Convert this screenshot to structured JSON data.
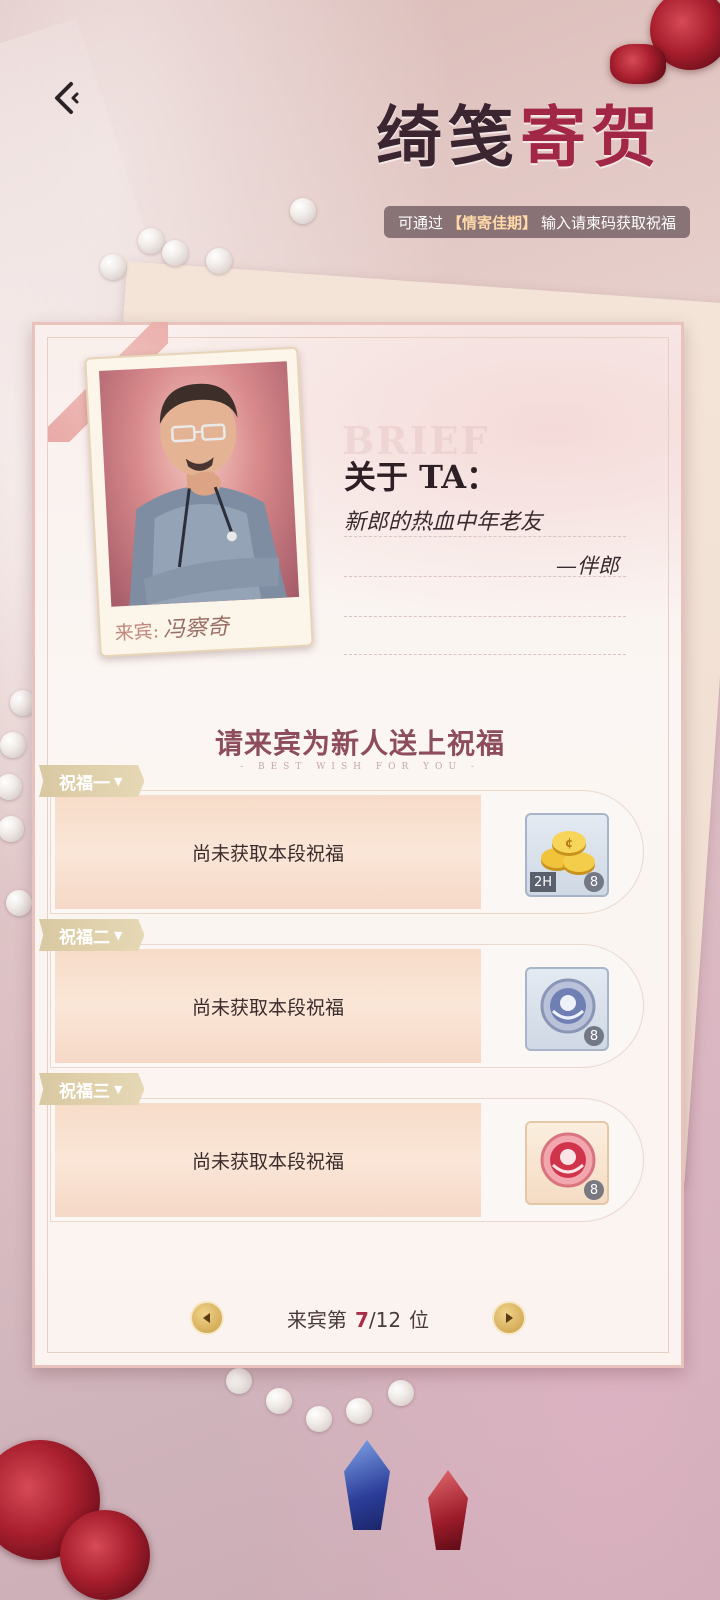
{
  "header": {
    "title_part1": "绮笺",
    "title_part2": "寄贺",
    "subtitle_pre": "可通过",
    "subtitle_highlight": "【情寄佳期】",
    "subtitle_post": "输入请柬码获取祝福"
  },
  "guest": {
    "caption_label": "来宾:",
    "name": "冯察奇",
    "about_title": "关于 TA：",
    "about_text": "新郎的热血中年老友",
    "about_sign": "—伴郎",
    "watermark": "BRIEF"
  },
  "section": {
    "title": "请来宾为新人送上祝福",
    "subtitle": "- BEST WISH FOR YOU -"
  },
  "blessings": [
    {
      "tag": "祝福一",
      "text": "尚未获取本段祝福",
      "reward": {
        "icon": "gold-coins-icon",
        "badge": "2H",
        "count": "8"
      }
    },
    {
      "tag": "祝福二",
      "text": "尚未获取本段祝福",
      "reward": {
        "icon": "silver-emblem-icon",
        "count": "8"
      }
    },
    {
      "tag": "祝福三",
      "text": "尚未获取本段祝福",
      "reward": {
        "icon": "red-emblem-icon",
        "count": "8"
      }
    }
  ],
  "pager": {
    "prefix": "来宾第",
    "current": "7",
    "total": "/12",
    "suffix": "位"
  },
  "colors": {
    "accent": "#a22746",
    "title_dark": "#3a2530",
    "tag_gold": "#d9c9a2"
  }
}
